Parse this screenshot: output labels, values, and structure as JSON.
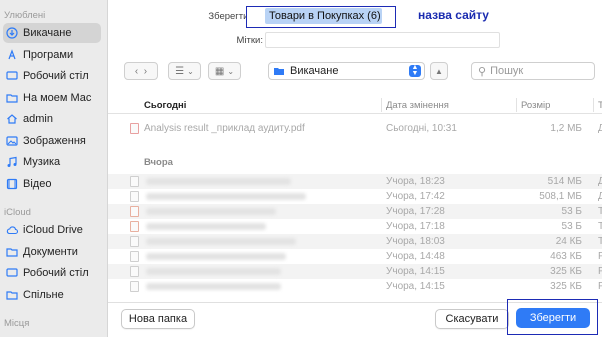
{
  "sidebar": {
    "section_favorites": "Улюблені",
    "favorites": [
      {
        "label": "Викачане",
        "icon": "download-icon",
        "selected": true
      },
      {
        "label": "Програми",
        "icon": "apps-icon",
        "selected": false
      },
      {
        "label": "Робочий стіл",
        "icon": "desktop-icon",
        "selected": false
      },
      {
        "label": "На моем Mac",
        "icon": "folder-icon",
        "selected": false
      },
      {
        "label": "admin",
        "icon": "home-icon",
        "selected": false
      },
      {
        "label": "Зображення",
        "icon": "photos-icon",
        "selected": false
      },
      {
        "label": "Музика",
        "icon": "music-icon",
        "selected": false
      },
      {
        "label": "Відео",
        "icon": "video-icon",
        "selected": false
      }
    ],
    "section_icloud": "iCloud",
    "icloud": [
      {
        "label": "iCloud Drive",
        "icon": "cloud-icon"
      },
      {
        "label": "Документи",
        "icon": "document-icon"
      },
      {
        "label": "Робочий стіл",
        "icon": "desktop-icon"
      },
      {
        "label": "Спільне",
        "icon": "shared-folder-icon"
      }
    ],
    "section_places": "Місця"
  },
  "form": {
    "save_as_label": "Зберегти як:",
    "save_as_value": "Товари в Покупках (6)",
    "tags_label": "Мітки:",
    "annotation": "назва сайту"
  },
  "toolbar": {
    "location": "Викачане",
    "search_placeholder": "Пошук"
  },
  "columns": {
    "name": "Сьогодні",
    "date": "Дата змінення",
    "size": "Розмір",
    "kind": "Т"
  },
  "today": [
    {
      "name": "Analysis result _приклад аудиту.pdf",
      "date": "Сьогодні, 10:31",
      "size": "1,2 МБ",
      "kind": "Д"
    }
  ],
  "yesterday_label": "Вчора",
  "yesterday": [
    {
      "date": "Учора, 18:23",
      "size": "514 МБ",
      "kind": "Д"
    },
    {
      "date": "Учора, 17:42",
      "size": "508,1 МБ",
      "kind": "Д"
    },
    {
      "date": "Учора, 17:28",
      "size": "53 Б",
      "kind": "Т"
    },
    {
      "date": "Учора, 17:18",
      "size": "53 Б",
      "kind": "Т"
    },
    {
      "date": "Учора, 18:03",
      "size": "24 КБ",
      "kind": "Т"
    },
    {
      "date": "Учора, 14:48",
      "size": "463 КБ",
      "kind": "Р"
    },
    {
      "date": "Учора, 14:15",
      "size": "325 КБ",
      "kind": "Р"
    },
    {
      "date": "Учора, 14:15",
      "size": "325 КБ",
      "kind": "Р"
    }
  ],
  "buttons": {
    "new_folder": "Нова папка",
    "cancel": "Скасувати",
    "save": "Зберегти"
  },
  "colors": {
    "accent": "#2f7bf6",
    "annotation": "#1d2bb5",
    "selection": "#b9d3f5"
  }
}
